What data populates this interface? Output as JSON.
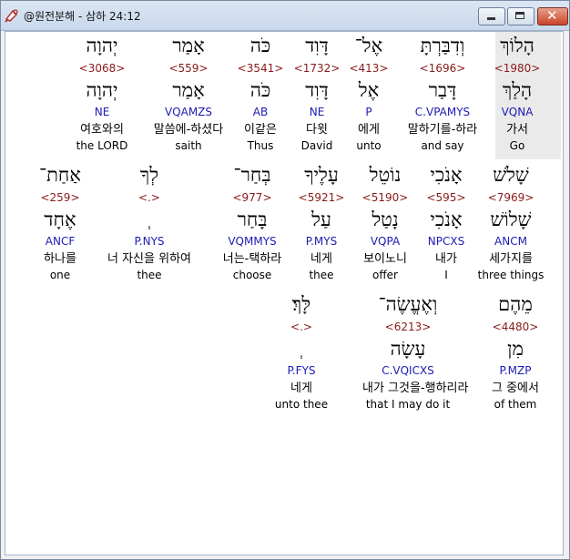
{
  "window": {
    "title": "@원전분해 - 삼하 24:12",
    "controls": {
      "minimize": "minimize",
      "maximize": "maximize",
      "close": "✕"
    }
  },
  "rows": [
    [
      {
        "hebrew": "יְהוָה",
        "strong": "<3068>",
        "lemma": "יְהוָה",
        "morph": "NE",
        "korean": "여호와의",
        "english": "the LORD"
      },
      {
        "hebrew": "אָמַר",
        "strong": "<559>",
        "lemma": "אָמַר",
        "morph": "VQAMZS",
        "korean": "말씀에-하셨다",
        "english": "saith"
      },
      {
        "hebrew": "כֹּה",
        "strong": "<3541>",
        "lemma": "כֹּה",
        "morph": "AB",
        "korean": "이같은",
        "english": "Thus"
      },
      {
        "hebrew": "דָּוִד",
        "strong": "<1732>",
        "lemma": "דָּוִד",
        "morph": "NE",
        "korean": "다윗",
        "english": "David"
      },
      {
        "hebrew": "אֶל־",
        "strong": "<413>",
        "lemma": "אֶל",
        "morph": "P",
        "korean": "에게",
        "english": "unto"
      },
      {
        "hebrew": "וְדִבַּרְתָּ",
        "strong": "<1696>",
        "lemma": "דָּבַר",
        "morph": "C.VPAMYS",
        "korean": "말하기를-하라",
        "english": "and say"
      },
      {
        "hebrew": "הָלוֹךְ",
        "strong": "<1980>",
        "lemma": "הָלַךְ",
        "morph": "VQNA",
        "korean": "가서",
        "english": "Go"
      }
    ],
    [
      {
        "hebrew": "אַחַת־",
        "strong": "<259>",
        "lemma": "אֶחָד",
        "morph": "ANCF",
        "korean": "하나를",
        "english": "one"
      },
      {
        "hebrew": "לְךָ",
        "strong": "<.>",
        "lemma": "ְ",
        "morph": "P.NYS",
        "korean": "너 자신을 위하여",
        "english": "thee"
      },
      {
        "hebrew": "בְּחַר־",
        "strong": "<977>",
        "lemma": "בָּחַר",
        "morph": "VQMMYS",
        "korean": "너는-택하라",
        "english": "choose"
      },
      {
        "hebrew": "עָלֶיךָ",
        "strong": "<5921>",
        "lemma": "עַל",
        "morph": "P.MYS",
        "korean": "네게",
        "english": "thee"
      },
      {
        "hebrew": "נוֹטֵל",
        "strong": "<5190>",
        "lemma": "נָטַל",
        "morph": "VQPA",
        "korean": "보이노니",
        "english": "offer"
      },
      {
        "hebrew": "אָנֹכִי",
        "strong": "<595>",
        "lemma": "אָנֹכִי",
        "morph": "NPCXS",
        "korean": "내가",
        "english": "I"
      },
      {
        "hebrew": "שָׁלֹשׁ",
        "strong": "<7969>",
        "lemma": "שָׁלוֹשׁ",
        "morph": "ANCM",
        "korean": "세가지를",
        "english": "three things"
      }
    ],
    [
      {
        "hebrew": "לָּךְ׃",
        "strong": "<.>",
        "lemma": "ְ",
        "morph": "P.FYS",
        "korean": "네게",
        "english": "unto thee"
      },
      {
        "hebrew": "וְאֶעֱשֶׂה־",
        "strong": "<6213>",
        "lemma": "עָשָׂה",
        "morph": "C.VQICXS",
        "korean": "내가 그것을-행하리라",
        "english": "that I may do it"
      },
      {
        "hebrew": "מֵהֶם",
        "strong": "<4480>",
        "lemma": "מִן",
        "morph": "P.MZP",
        "korean": "그 중에서",
        "english": "of them"
      }
    ]
  ]
}
